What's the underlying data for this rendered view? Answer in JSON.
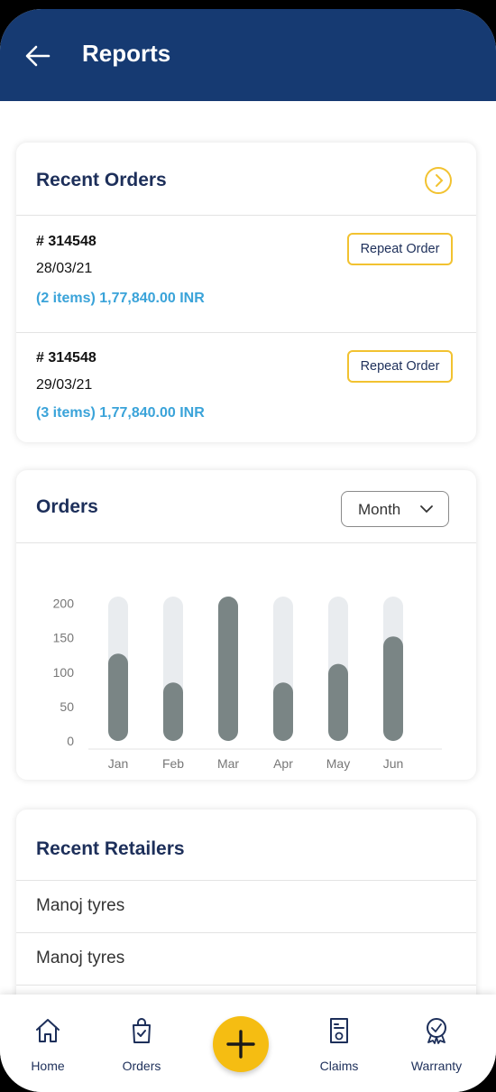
{
  "header": {
    "title": "Reports"
  },
  "recent_orders": {
    "title": "Recent Orders",
    "orders": [
      {
        "id": "# 314548",
        "date": "28/03/21",
        "summary": "(2 items) 1,77,840.00 INR",
        "action": "Repeat Order"
      },
      {
        "id": "# 314548",
        "date": "29/03/21",
        "summary": "(3 items) 1,77,840.00 INR",
        "action": "Repeat Order"
      }
    ]
  },
  "orders_chart": {
    "title": "Orders",
    "period": "Month"
  },
  "chart_data": {
    "type": "bar",
    "categories": [
      "Jan",
      "Feb",
      "Mar",
      "Apr",
      "May",
      "Jun"
    ],
    "values": [
      127,
      85,
      210,
      85,
      112,
      152
    ],
    "ylim": [
      0,
      210
    ],
    "yticks": [
      0,
      50,
      100,
      150,
      200
    ],
    "title": "",
    "xlabel": "",
    "ylabel": "",
    "bar_color": "#7a8585",
    "track_color": "#e9ecef",
    "grid": false
  },
  "recent_retailers": {
    "title": "Recent Retailers",
    "items": [
      "Manoj tyres",
      "Manoj tyres"
    ]
  },
  "bottom_nav": {
    "home": "Home",
    "orders": "Orders",
    "claims": "Claims",
    "warranty": "Warranty"
  },
  "colors": {
    "header": "#163a72",
    "accent": "#f5bd12",
    "link": "#3aa3d9"
  }
}
